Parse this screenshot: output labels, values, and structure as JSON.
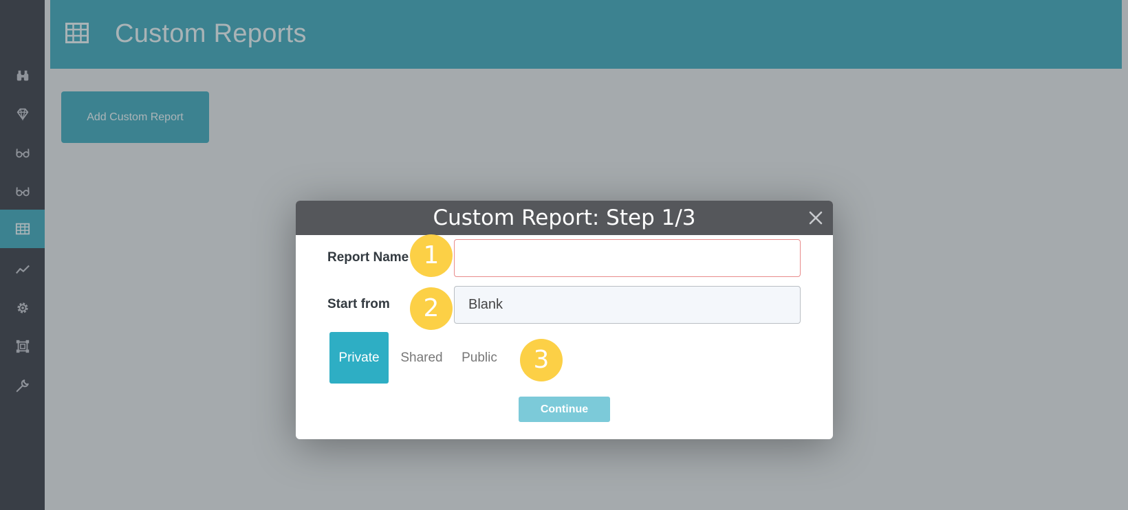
{
  "header": {
    "title": "Custom Reports"
  },
  "main": {
    "add_button_label": "Add Custom Report"
  },
  "sidebar": {
    "items": [
      {
        "icon": "binoculars-icon"
      },
      {
        "icon": "diamond-icon"
      },
      {
        "icon": "glasses-icon"
      },
      {
        "icon": "glasses-icon"
      },
      {
        "icon": "table-icon",
        "active": true
      },
      {
        "icon": "line-chart-icon"
      },
      {
        "icon": "gear-icon"
      },
      {
        "icon": "frame-icon"
      },
      {
        "icon": "wrench-icon"
      }
    ]
  },
  "modal": {
    "title": "Custom Report: Step 1/3",
    "report_name_label": "Report Name",
    "report_name_value": "",
    "start_from_label": "Start from",
    "start_from_value": "Blank",
    "visibility_options": [
      "Private",
      "Shared",
      "Public"
    ],
    "selected_visibility": "Private",
    "continue_label": "Continue"
  },
  "annotations": [
    "1",
    "2",
    "3"
  ],
  "colors": {
    "accent": "#2a9fb3",
    "sidebar_bg": "#252a34",
    "modal_header_bg": "#55575b",
    "badge": "#fcd046",
    "continue": "#7ccad9",
    "error_border": "#e88a8a"
  }
}
